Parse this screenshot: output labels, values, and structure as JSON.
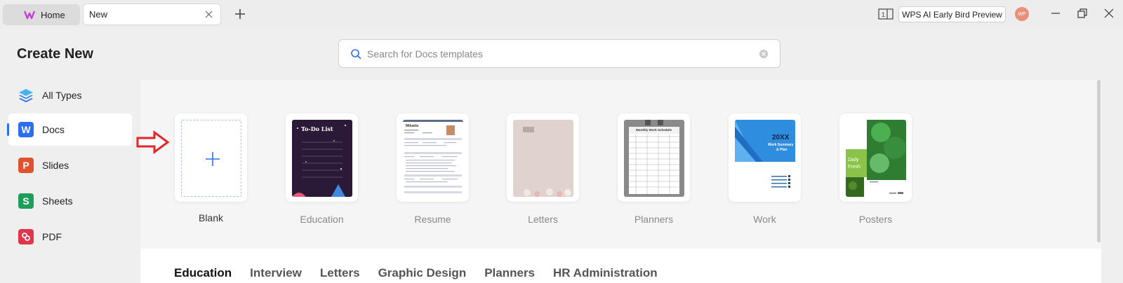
{
  "titlebar": {
    "home_tab": "Home",
    "doc_tab": "New",
    "preview_button": "WPS AI Early Bird Preview",
    "avatar": "WP"
  },
  "sidebar": {
    "title": "Create New",
    "items": [
      {
        "label": "All Types",
        "icon": "layers-icon",
        "color": "#2b6ef2"
      },
      {
        "label": "Docs",
        "icon": "docs-icon",
        "letter": "W",
        "color": "#2b6ef2",
        "active": true
      },
      {
        "label": "Slides",
        "icon": "slides-icon",
        "letter": "P",
        "color": "#e2512d"
      },
      {
        "label": "Sheets",
        "icon": "sheets-icon",
        "letter": "S",
        "color": "#1f9d5a"
      },
      {
        "label": "PDF",
        "icon": "pdf-icon",
        "letter": "",
        "color": "#e2344a"
      }
    ]
  },
  "search": {
    "placeholder": "Search for Docs templates",
    "value": ""
  },
  "templates": [
    {
      "label": "Blank"
    },
    {
      "label": "Education",
      "thumb_title": "To-Do List"
    },
    {
      "label": "Resume",
      "thumb_name": "Mikaela"
    },
    {
      "label": "Letters"
    },
    {
      "label": "Planners",
      "thumb_title": "Monthly Work Schedule"
    },
    {
      "label": "Work",
      "thumb_year": "20XX",
      "thumb_line1": "Work Summary",
      "thumb_line2": "& Plan"
    },
    {
      "label": "Posters",
      "thumb_line1": "Daily",
      "thumb_line2": "Fresh"
    }
  ],
  "categories": [
    "Education",
    "Interview",
    "Letters",
    "Graphic Design",
    "Planners",
    "HR Administration"
  ],
  "colors": {
    "accent": "#2b6ef2",
    "arrow": "#e0262b"
  }
}
